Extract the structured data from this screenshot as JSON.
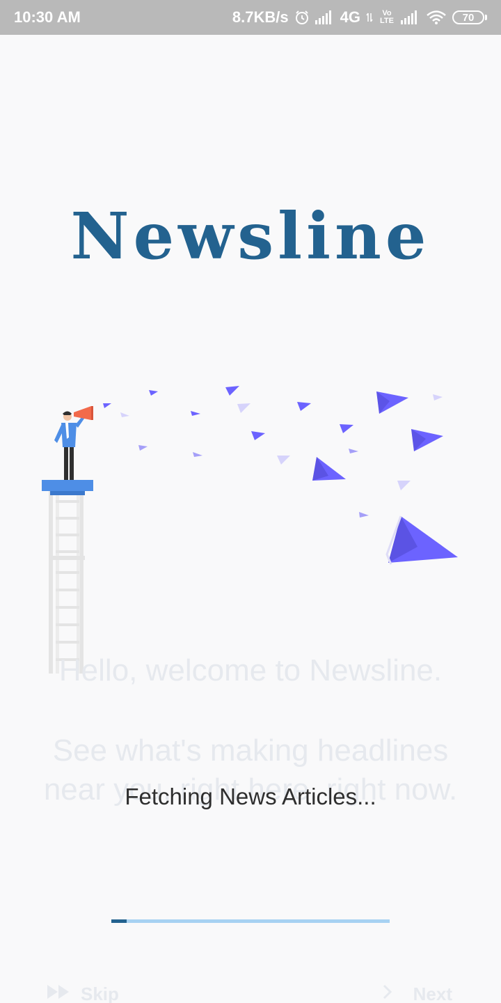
{
  "status_bar": {
    "time": "10:30 AM",
    "speed": "8.7KB/s",
    "network": "4G",
    "volte": "Vo LTE",
    "battery": "70"
  },
  "app": {
    "title": "Newsline"
  },
  "onboarding": {
    "heading": "Hello, welcome to Newsline.",
    "body": "See what's making headlines near you, right here, right now."
  },
  "loading": {
    "text": "Fetching News Articles...",
    "progress": 0.055
  },
  "nav": {
    "skip_label": "Skip",
    "next_label": "Next"
  },
  "colors": {
    "brand": "#23628f",
    "progress_track": "#a7d2f2",
    "plane": "#6c63ff",
    "plane_light": "#d6d3fb",
    "megaphone": "#f26a4b",
    "tower": "#4e8ee6"
  }
}
